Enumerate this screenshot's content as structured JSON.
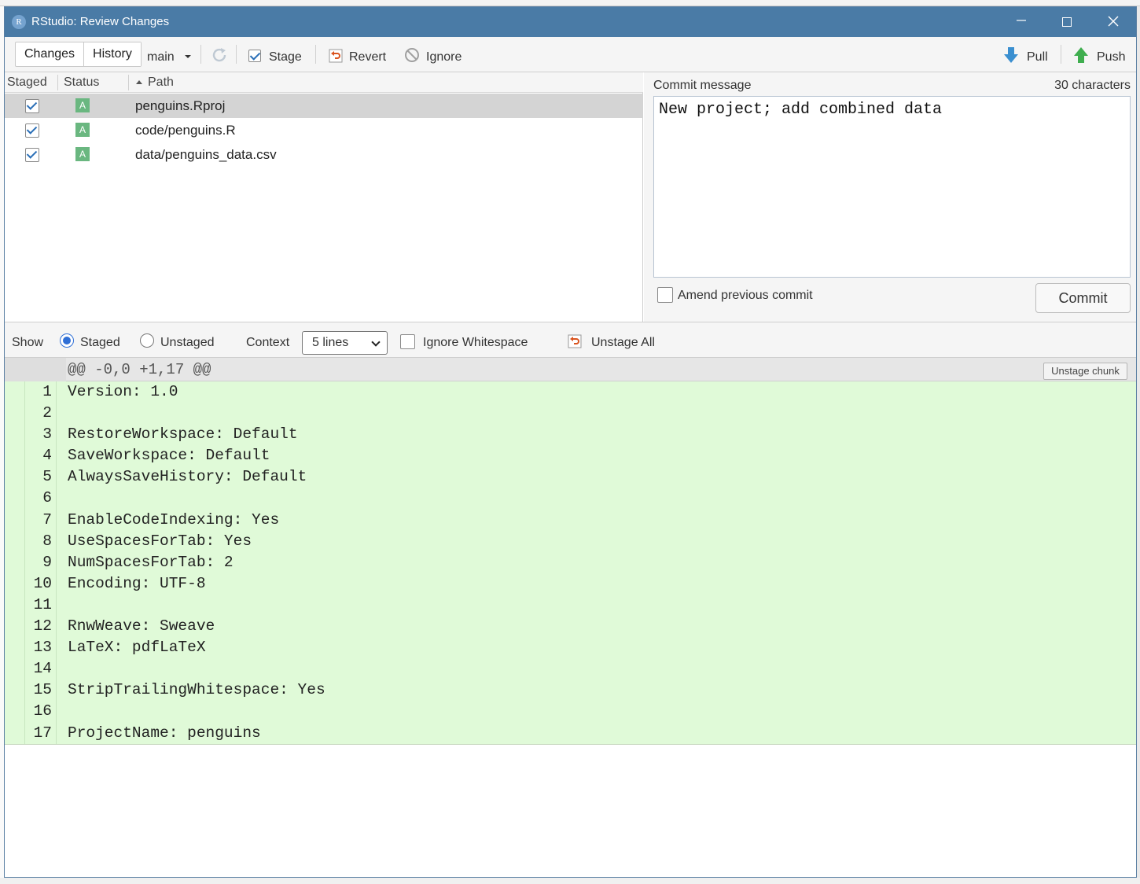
{
  "window": {
    "title": "RStudio: Review Changes",
    "icon_letter": "R"
  },
  "toolbar": {
    "tabs": [
      "Changes",
      "History"
    ],
    "branch": "main",
    "stage_label": "Stage",
    "revert_label": "Revert",
    "ignore_label": "Ignore",
    "pull_label": "Pull",
    "push_label": "Push"
  },
  "files": {
    "headers": {
      "staged": "Staged",
      "status": "Status",
      "path": "Path"
    },
    "rows": [
      {
        "staged": true,
        "status": "A",
        "path": "penguins.Rproj",
        "selected": true
      },
      {
        "staged": true,
        "status": "A",
        "path": "code/penguins.R",
        "selected": false
      },
      {
        "staged": true,
        "status": "A",
        "path": "data/penguins_data.csv",
        "selected": false
      }
    ]
  },
  "commit": {
    "label": "Commit message",
    "count": "30 characters",
    "message": "New project; add combined data",
    "amend_label": "Amend previous commit",
    "amend_checked": false,
    "commit_label": "Commit"
  },
  "diff_toolbar": {
    "show_label": "Show",
    "staged_label": "Staged",
    "unstaged_label": "Unstaged",
    "selected_show": "Staged",
    "context_label": "Context",
    "context_value": "5 lines",
    "ignore_ws_label": "Ignore Whitespace",
    "ignore_ws_checked": false,
    "unstage_all_label": "Unstage All"
  },
  "diff": {
    "hunk_header": "@@ -0,0 +1,17 @@",
    "unstage_chunk_label": "Unstage chunk",
    "lines": [
      {
        "n": "1",
        "text": "Version: 1.0"
      },
      {
        "n": "2",
        "text": ""
      },
      {
        "n": "3",
        "text": "RestoreWorkspace: Default"
      },
      {
        "n": "4",
        "text": "SaveWorkspace: Default"
      },
      {
        "n": "5",
        "text": "AlwaysSaveHistory: Default"
      },
      {
        "n": "6",
        "text": ""
      },
      {
        "n": "7",
        "text": "EnableCodeIndexing: Yes"
      },
      {
        "n": "8",
        "text": "UseSpacesForTab: Yes"
      },
      {
        "n": "9",
        "text": "NumSpacesForTab: 2"
      },
      {
        "n": "10",
        "text": "Encoding: UTF-8"
      },
      {
        "n": "11",
        "text": ""
      },
      {
        "n": "12",
        "text": "RnwWeave: Sweave"
      },
      {
        "n": "13",
        "text": "LaTeX: pdfLaTeX"
      },
      {
        "n": "14",
        "text": ""
      },
      {
        "n": "15",
        "text": "StripTrailingWhitespace: Yes"
      },
      {
        "n": "16",
        "text": ""
      },
      {
        "n": "17",
        "text": "ProjectName: penguins"
      }
    ]
  },
  "colors": {
    "titlebar": "#4a7ba6",
    "added_line_bg": "#e0fad8",
    "status_added": "#6ab780",
    "pull_arrow": "#3a8fd0",
    "push_arrow": "#3fae4f"
  }
}
